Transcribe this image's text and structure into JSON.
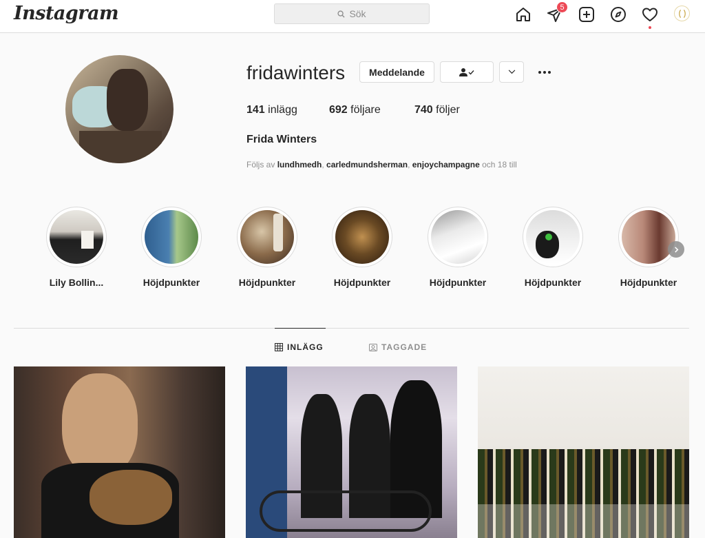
{
  "nav": {
    "logo": "Instagram",
    "search_placeholder": "Sök",
    "direct_badge": "5",
    "icons": [
      "home-icon",
      "direct-icon",
      "new-post-icon",
      "explore-icon",
      "activity-heart-icon",
      "profile-avatar"
    ]
  },
  "profile": {
    "username": "fridawinters",
    "message_label": "Meddelande",
    "stats": {
      "posts_count": "141",
      "posts_label": "inlägg",
      "followers_count": "692",
      "followers_label": "följare",
      "following_count": "740",
      "following_label": "följer"
    },
    "full_name": "Frida Winters",
    "followed_by_prefix": "Följs av",
    "followed_by_users": [
      "lundhmedh",
      "carledmundsherman",
      "enjoychampagne"
    ],
    "followed_by_suffix": "och 18 till"
  },
  "highlights": [
    {
      "label": "Lily Bollin..."
    },
    {
      "label": "Höjdpunkter"
    },
    {
      "label": "Höjdpunkter"
    },
    {
      "label": "Höjdpunkter"
    },
    {
      "label": "Höjdpunkter"
    },
    {
      "label": "Höjdpunkter"
    },
    {
      "label": "Höjdpunkter"
    }
  ],
  "tabs": {
    "posts": "INLÄGG",
    "tagged": "TAGGADE"
  },
  "colors": {
    "badge": "#ed4956",
    "border": "#dbdbdb",
    "text": "#262626",
    "muted": "#8e8e8e"
  }
}
